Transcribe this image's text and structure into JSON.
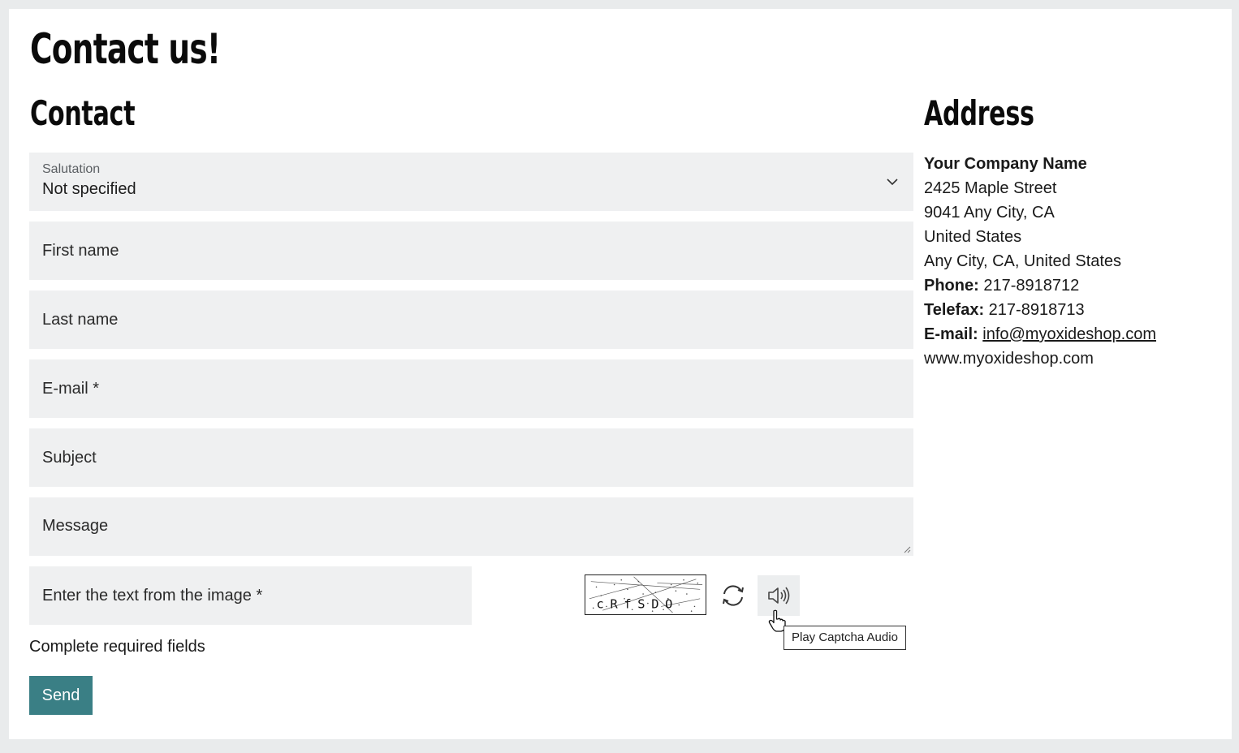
{
  "page": {
    "title": "Contact us!"
  },
  "contact": {
    "title": "Contact",
    "salutation": {
      "label": "Salutation",
      "value": "Not specified"
    },
    "fields": {
      "first_name": "First name",
      "last_name": "Last name",
      "email": "E-mail *",
      "subject": "Subject",
      "message": "Message",
      "captcha": "Enter the text from the image *"
    },
    "captcha_text": "cRfSDO",
    "audio_tooltip": "Play Captcha Audio",
    "required_note": "Complete required fields",
    "send_label": "Send"
  },
  "address": {
    "title": "Address",
    "company": "Your Company Name",
    "street": "2425 Maple Street",
    "city_line": "9041 Any City, CA",
    "country": "United States",
    "full_city": "Any City, CA, United States",
    "phone_label": "Phone:",
    "phone": "217-8918712",
    "fax_label": "Telefax:",
    "fax": "217-8918713",
    "email_label": "E-mail:",
    "email": "info@myoxideshop.com",
    "website": "www.myoxideshop.com"
  },
  "colors": {
    "accent": "#3a7f85",
    "field_bg": "#eff0f1",
    "page_bg": "#e9ebec"
  },
  "icons": {
    "select": "chevron-down-icon",
    "refresh": "refresh-icon",
    "audio": "speaker-icon",
    "cursor": "hand-pointer-icon",
    "resize": "resize-grip-icon"
  }
}
